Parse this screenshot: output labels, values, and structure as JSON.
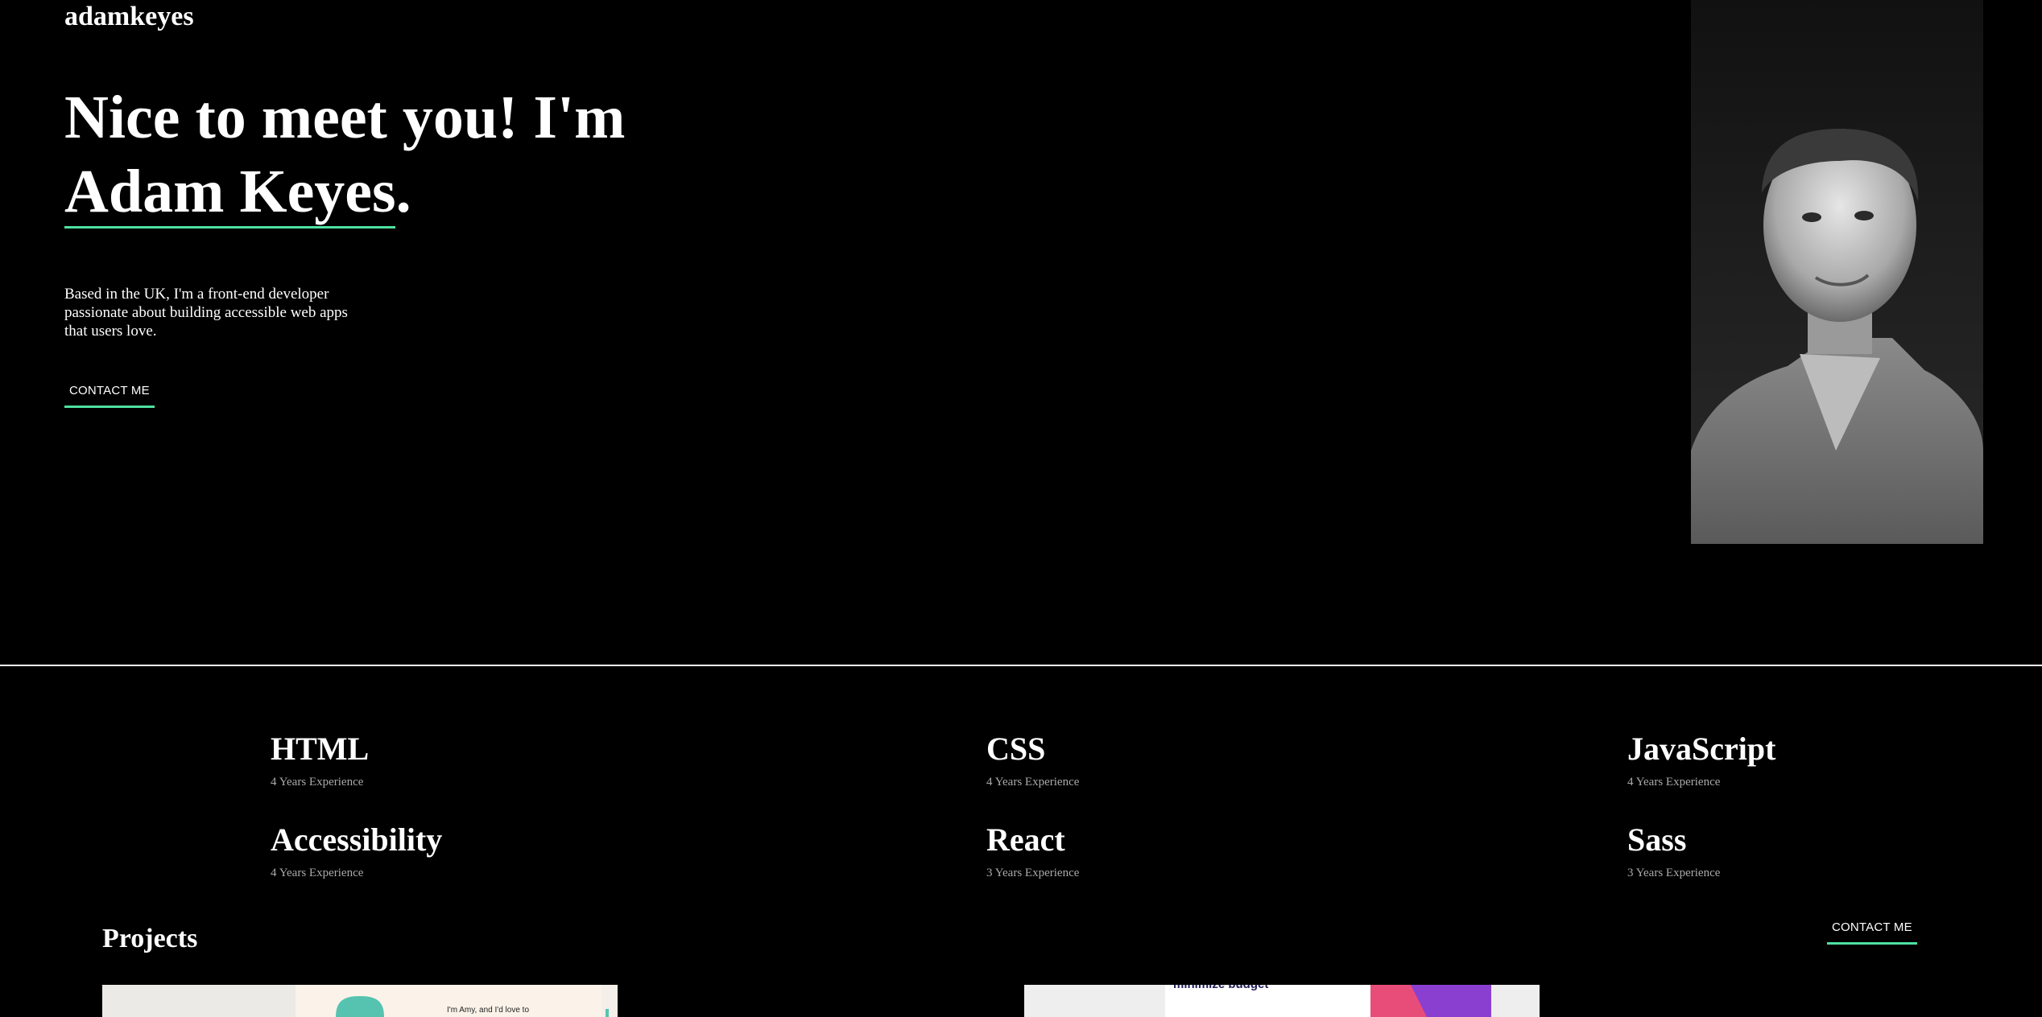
{
  "header": {
    "logo": "adamkeyes",
    "socials": [
      {
        "name": "github-icon"
      },
      {
        "name": "frontend-mentor-icon"
      },
      {
        "name": "linkedin-icon"
      },
      {
        "name": "twitter-icon"
      }
    ]
  },
  "hero": {
    "title_line1": "Nice to meet you! I'm",
    "title_name": "Adam Keyes",
    "title_end": ".",
    "bio": "Based in the UK, I'm a front-end developer passionate about building accessible web apps that users love.",
    "cta": "CONTACT ME"
  },
  "skills": [
    {
      "name": "HTML",
      "experience": "4 Years Experience"
    },
    {
      "name": "CSS",
      "experience": "4 Years Experience"
    },
    {
      "name": "JavaScript",
      "experience": "4 Years Experience"
    },
    {
      "name": "Accessibility",
      "experience": "4 Years Experience"
    },
    {
      "name": "React",
      "experience": "3 Years Experience"
    },
    {
      "name": "Sass",
      "experience": "3 Years Experience"
    }
  ],
  "projects": {
    "title": "Projects",
    "cta": "CONTACT ME",
    "thumb1_text": "I'm Amy, and I'd love to",
    "thumb2_text": "minimize budget"
  },
  "colors": {
    "accent": "#4ee1a0",
    "background": "#000000",
    "text": "#ffffff",
    "muted": "#aaaaaa"
  }
}
